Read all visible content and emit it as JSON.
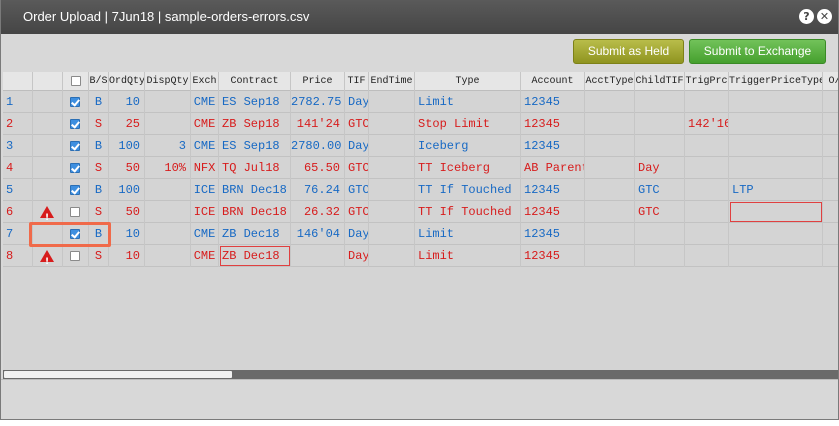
{
  "window": {
    "title": "Order Upload | 7Jun18 | sample-orders-errors.csv"
  },
  "icons": {
    "help": "help-icon",
    "close": "close-icon",
    "warning": "warning-icon",
    "checkbox": "checkbox-icon"
  },
  "toolbar": {
    "submit_held": "Submit as Held",
    "submit_exchange": "Submit to Exchange"
  },
  "columns": [
    "",
    "",
    "",
    "B/S",
    "OrdQty",
    "DispQty",
    "Exch",
    "Contract",
    "Price",
    "TIF",
    "EndTime",
    "Type",
    "Account",
    "AcctType",
    "ChildTIF",
    "TrigPrc",
    "TriggerPriceType",
    "O/C"
  ],
  "colors": {
    "buy": "#1769c4",
    "sell": "#d71c1c",
    "error": "#e04040",
    "highlight": "#f06a4a"
  },
  "rows": [
    {
      "num": "1",
      "warn": false,
      "checked": true,
      "side": "B",
      "ordqty": "10",
      "dispqty": "",
      "exch": "CME",
      "contract": "ES Sep18",
      "price": "2782.75",
      "tif": "Day",
      "endtime": "",
      "type": "Limit",
      "account": "12345",
      "accttype": "",
      "childtif": "",
      "trigprc": "",
      "trigtype": ""
    },
    {
      "num": "2",
      "warn": false,
      "checked": true,
      "side": "S",
      "ordqty": "25",
      "dispqty": "",
      "exch": "CME",
      "contract": "ZB Sep18",
      "price": "141'24",
      "tif": "GTC",
      "endtime": "",
      "type": "Stop Limit",
      "account": "12345",
      "accttype": "",
      "childtif": "",
      "trigprc": "142'16",
      "trigtype": ""
    },
    {
      "num": "3",
      "warn": false,
      "checked": true,
      "side": "B",
      "ordqty": "100",
      "dispqty": "3",
      "exch": "CME",
      "contract": "ES Sep18",
      "price": "2780.00",
      "tif": "Day",
      "endtime": "",
      "type": "Iceberg",
      "account": "12345",
      "accttype": "",
      "childtif": "",
      "trigprc": "",
      "trigtype": ""
    },
    {
      "num": "4",
      "warn": false,
      "checked": true,
      "side": "S",
      "ordqty": "50",
      "dispqty": "10%",
      "exch": "NFX",
      "contract": "TQ Jul18",
      "price": "65.50",
      "tif": "GTC",
      "endtime": "",
      "type": "TT Iceberg",
      "account": "AB Parent",
      "accttype": "",
      "childtif": "Day",
      "trigprc": "",
      "trigtype": ""
    },
    {
      "num": "5",
      "warn": false,
      "checked": true,
      "side": "B",
      "ordqty": "100",
      "dispqty": "",
      "exch": "ICE",
      "contract": "BRN Dec18",
      "price": "76.24",
      "tif": "GTC",
      "endtime": "",
      "type": "TT If Touched",
      "account": "12345",
      "accttype": "",
      "childtif": "GTC",
      "trigprc": "",
      "trigtype": "LTP"
    },
    {
      "num": "6",
      "warn": true,
      "checked": false,
      "side": "S",
      "ordqty": "50",
      "dispqty": "",
      "exch": "ICE",
      "contract": "BRN Dec18",
      "price": "26.32",
      "tif": "GTC",
      "endtime": "",
      "type": "TT If Touched",
      "account": "12345",
      "accttype": "",
      "childtif": "GTC",
      "trigprc": "",
      "trigtype": ""
    },
    {
      "num": "7",
      "warn": false,
      "checked": true,
      "side": "B",
      "ordqty": "10",
      "dispqty": "",
      "exch": "CME",
      "contract": "ZB Dec18",
      "price": "146'04",
      "tif": "Day",
      "endtime": "",
      "type": "Limit",
      "account": "12345",
      "accttype": "",
      "childtif": "",
      "trigprc": "",
      "trigtype": ""
    },
    {
      "num": "8",
      "warn": true,
      "checked": false,
      "side": "S",
      "ordqty": "10",
      "dispqty": "",
      "exch": "CME",
      "contract": "ZB Dec18",
      "price": "",
      "tif": "Day",
      "endtime": "",
      "type": "Limit",
      "account": "12345",
      "accttype": "",
      "childtif": "",
      "trigprc": "",
      "trigtype": ""
    }
  ]
}
